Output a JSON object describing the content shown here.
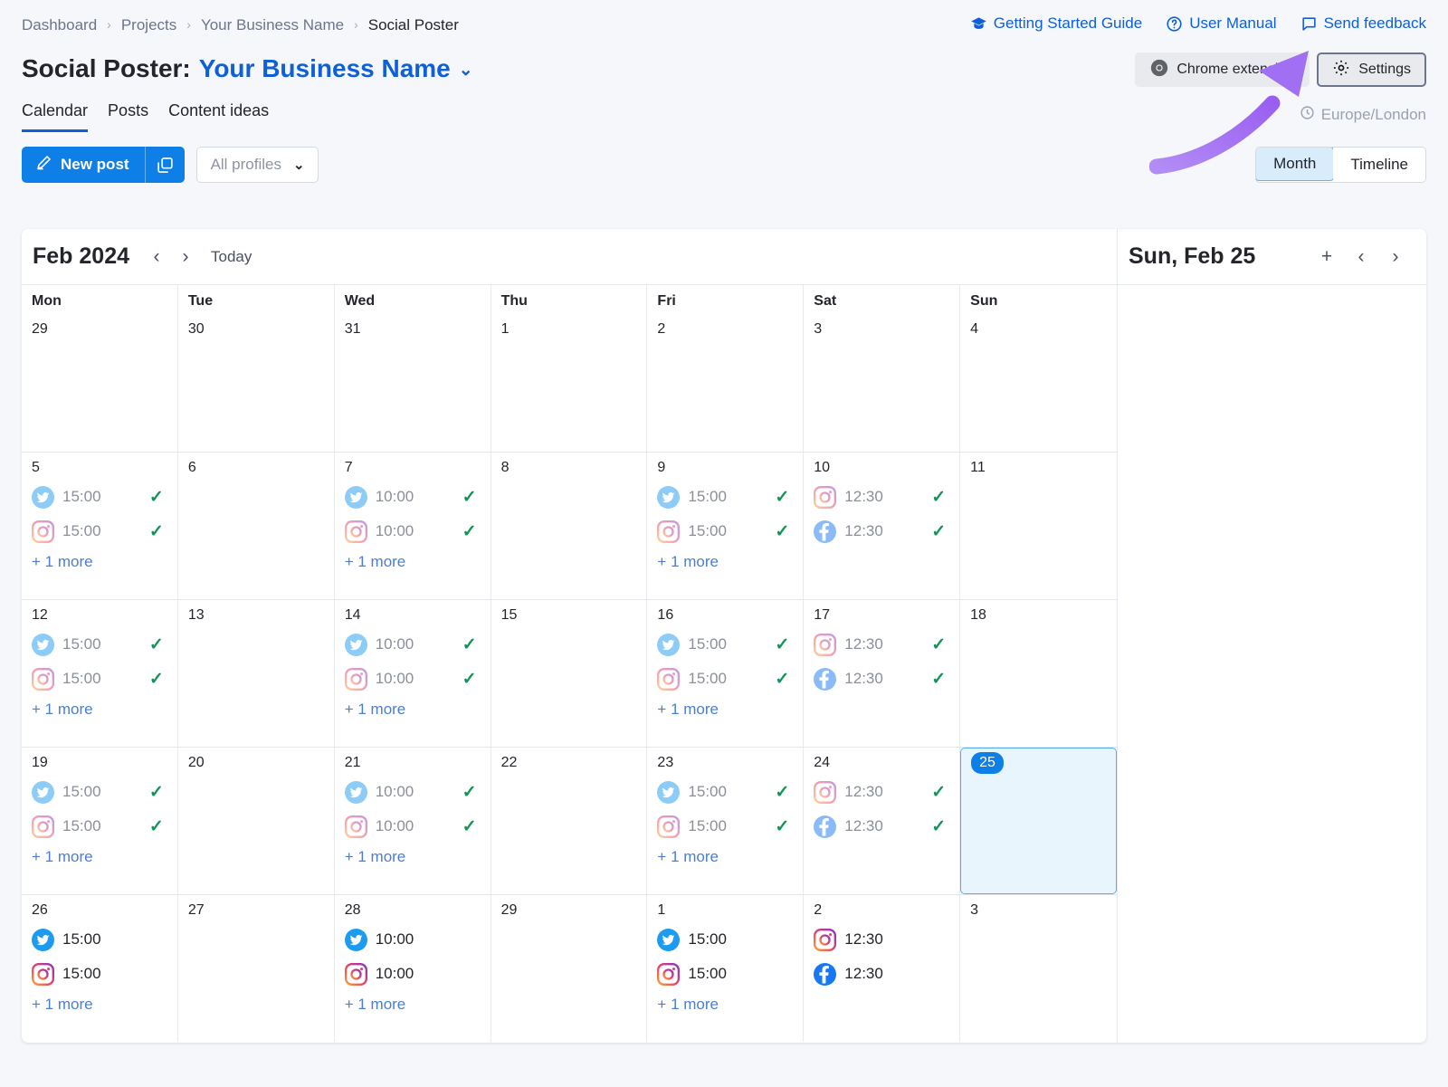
{
  "breadcrumb": {
    "items": [
      "Dashboard",
      "Projects",
      "Your Business Name",
      "Social Poster"
    ],
    "separator": "›"
  },
  "top_links": [
    {
      "label": "Getting Started Guide",
      "icon": "graduation-cap-icon"
    },
    {
      "label": "User Manual",
      "icon": "question-circle-icon"
    },
    {
      "label": "Send feedback",
      "icon": "feedback-flag-icon"
    }
  ],
  "header": {
    "title_prefix": "Social Poster:",
    "business_name": "Your Business Name",
    "caret": "⌄",
    "chrome_extension_label": "Chrome extension",
    "settings_label": "Settings",
    "timezone": "Europe/London"
  },
  "tabs": [
    {
      "label": "Calendar",
      "active": true
    },
    {
      "label": "Posts",
      "active": false
    },
    {
      "label": "Content ideas",
      "active": false
    }
  ],
  "toolbar": {
    "new_post_label": "New post",
    "duplicate_icon": "duplicate-icon",
    "profiles_value": "All profiles",
    "profiles_caret": "⌄",
    "view_options": [
      {
        "label": "Month",
        "active": true
      },
      {
        "label": "Timeline",
        "active": false
      }
    ]
  },
  "calendar": {
    "month_label": "Feb 2024",
    "prev_label": "‹",
    "next_label": "›",
    "today_label": "Today",
    "day_headers": [
      "Mon",
      "Tue",
      "Wed",
      "Thu",
      "Fri",
      "Sat",
      "Sun"
    ],
    "more_label": "+ 1 more",
    "check_glyph": "✓",
    "weeks": [
      {
        "days": [
          {
            "num": "29",
            "posts": [],
            "more": false,
            "selected": false
          },
          {
            "num": "30",
            "posts": [],
            "more": false,
            "selected": false
          },
          {
            "num": "31",
            "posts": [],
            "more": false,
            "selected": false
          },
          {
            "num": "1",
            "posts": [],
            "more": false,
            "selected": false
          },
          {
            "num": "2",
            "posts": [],
            "more": false,
            "selected": false
          },
          {
            "num": "3",
            "posts": [],
            "more": false,
            "selected": false
          },
          {
            "num": "4",
            "posts": [],
            "more": false,
            "selected": false
          }
        ]
      },
      {
        "days": [
          {
            "num": "5",
            "more": true,
            "selected": false,
            "posts": [
              {
                "network": "twitter",
                "time": "15:00",
                "published": true
              },
              {
                "network": "instagram",
                "time": "15:00",
                "published": true
              }
            ]
          },
          {
            "num": "6",
            "more": false,
            "selected": false,
            "posts": []
          },
          {
            "num": "7",
            "more": true,
            "selected": false,
            "posts": [
              {
                "network": "twitter",
                "time": "10:00",
                "published": true
              },
              {
                "network": "instagram",
                "time": "10:00",
                "published": true
              }
            ]
          },
          {
            "num": "8",
            "more": false,
            "selected": false,
            "posts": []
          },
          {
            "num": "9",
            "more": true,
            "selected": false,
            "posts": [
              {
                "network": "twitter",
                "time": "15:00",
                "published": true
              },
              {
                "network": "instagram",
                "time": "15:00",
                "published": true
              }
            ]
          },
          {
            "num": "10",
            "more": false,
            "selected": false,
            "posts": [
              {
                "network": "instagram",
                "time": "12:30",
                "published": true
              },
              {
                "network": "facebook",
                "time": "12:30",
                "published": true
              }
            ]
          },
          {
            "num": "11",
            "more": false,
            "selected": false,
            "posts": []
          }
        ]
      },
      {
        "days": [
          {
            "num": "12",
            "more": true,
            "selected": false,
            "posts": [
              {
                "network": "twitter",
                "time": "15:00",
                "published": true
              },
              {
                "network": "instagram",
                "time": "15:00",
                "published": true
              }
            ]
          },
          {
            "num": "13",
            "more": false,
            "selected": false,
            "posts": []
          },
          {
            "num": "14",
            "more": true,
            "selected": false,
            "posts": [
              {
                "network": "twitter",
                "time": "10:00",
                "published": true
              },
              {
                "network": "instagram",
                "time": "10:00",
                "published": true
              }
            ]
          },
          {
            "num": "15",
            "more": false,
            "selected": false,
            "posts": []
          },
          {
            "num": "16",
            "more": true,
            "selected": false,
            "posts": [
              {
                "network": "twitter",
                "time": "15:00",
                "published": true
              },
              {
                "network": "instagram",
                "time": "15:00",
                "published": true
              }
            ]
          },
          {
            "num": "17",
            "more": false,
            "selected": false,
            "posts": [
              {
                "network": "instagram",
                "time": "12:30",
                "published": true
              },
              {
                "network": "facebook",
                "time": "12:30",
                "published": true
              }
            ]
          },
          {
            "num": "18",
            "more": false,
            "selected": false,
            "posts": []
          }
        ]
      },
      {
        "days": [
          {
            "num": "19",
            "more": true,
            "selected": false,
            "posts": [
              {
                "network": "twitter",
                "time": "15:00",
                "published": true
              },
              {
                "network": "instagram",
                "time": "15:00",
                "published": true
              }
            ]
          },
          {
            "num": "20",
            "more": false,
            "selected": false,
            "posts": []
          },
          {
            "num": "21",
            "more": true,
            "selected": false,
            "posts": [
              {
                "network": "twitter",
                "time": "10:00",
                "published": true
              },
              {
                "network": "instagram",
                "time": "10:00",
                "published": true
              }
            ]
          },
          {
            "num": "22",
            "more": false,
            "selected": false,
            "posts": []
          },
          {
            "num": "23",
            "more": true,
            "selected": false,
            "posts": [
              {
                "network": "twitter",
                "time": "15:00",
                "published": true
              },
              {
                "network": "instagram",
                "time": "15:00",
                "published": true
              }
            ]
          },
          {
            "num": "24",
            "more": false,
            "selected": false,
            "posts": [
              {
                "network": "instagram",
                "time": "12:30",
                "published": true
              },
              {
                "network": "facebook",
                "time": "12:30",
                "published": true
              }
            ]
          },
          {
            "num": "25",
            "more": false,
            "selected": true,
            "posts": []
          }
        ]
      },
      {
        "days": [
          {
            "num": "26",
            "more": true,
            "selected": false,
            "posts": [
              {
                "network": "twitter",
                "time": "15:00",
                "published": false
              },
              {
                "network": "instagram",
                "time": "15:00",
                "published": false
              }
            ]
          },
          {
            "num": "27",
            "more": false,
            "selected": false,
            "posts": []
          },
          {
            "num": "28",
            "more": true,
            "selected": false,
            "posts": [
              {
                "network": "twitter",
                "time": "10:00",
                "published": false
              },
              {
                "network": "instagram",
                "time": "10:00",
                "published": false
              }
            ]
          },
          {
            "num": "29",
            "more": false,
            "selected": false,
            "posts": []
          },
          {
            "num": "1",
            "more": true,
            "selected": false,
            "posts": [
              {
                "network": "twitter",
                "time": "15:00",
                "published": false
              },
              {
                "network": "instagram",
                "time": "15:00",
                "published": false
              }
            ]
          },
          {
            "num": "2",
            "more": false,
            "selected": false,
            "posts": [
              {
                "network": "instagram",
                "time": "12:30",
                "published": false
              },
              {
                "network": "facebook",
                "time": "12:30",
                "published": false
              }
            ]
          },
          {
            "num": "3",
            "more": false,
            "selected": false,
            "posts": []
          }
        ]
      }
    ]
  },
  "side_panel": {
    "date_label": "Sun, Feb 25",
    "add_label": "+",
    "prev_label": "‹",
    "next_label": "›"
  },
  "annotation": {
    "shape": "curved-arrow",
    "color": "#a971f0",
    "points_to": "Settings"
  },
  "colors": {
    "accent_blue": "#0f7fe8",
    "link_blue": "#0e5fd8",
    "check_green": "#129456",
    "selected_bg": "#e8f5fd",
    "selected_border": "#54aeea",
    "page_bg": "#f5f7fa",
    "arrow_purple": "#a971f0"
  }
}
